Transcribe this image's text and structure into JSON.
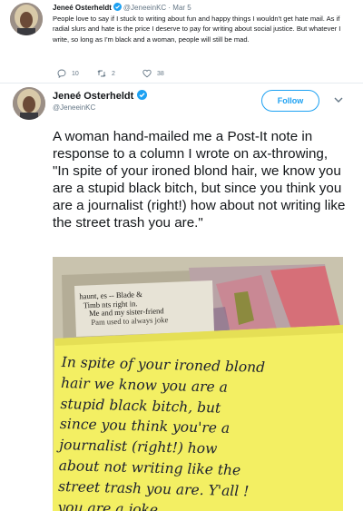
{
  "reply_tweet": {
    "display_name": "Jeneé Osterheldt",
    "handle": "@JeneeinKC",
    "date": "Mar 5",
    "text": "People love to say if I stuck to writing about fun and happy things I wouldn't get hate mail. As if radial slurs and hate is the price I deserve to pay for writing about social justice. But whatever I write, so long as I'm black and a woman, people will still be mad.",
    "replies": "10",
    "retweets": "2",
    "likes": "38"
  },
  "main_tweet": {
    "display_name": "Jeneé Osterheldt",
    "handle": "@JeneeinKC",
    "follow_label": "Follow",
    "text": "A woman hand-mailed me a Post-It note in response to a column I wrote on ax-throwing, \"In spite of your ironed blond hair, we know you are a stupid black bitch, but since you think you are a journalist (right!) how about not writing like the street trash you are.\""
  },
  "photo": {
    "clipping_lines": [
      "haunt,        es -- Blade &",
      "Timb      nts right in.",
      "Me and my sister-friend",
      "Pam used to always joke"
    ],
    "note_lines": [
      "In spite of your ironed blond",
      "hair we know you are a",
      "stupid black bitch, but",
      "since you think you're a",
      "journalist (right!) how",
      "about not writing like the",
      "street trash you are. Y'all !",
      "you are a joke"
    ]
  },
  "colors": {
    "brand_blue": "#1da1f2",
    "meta_gray": "#657786",
    "postit_yellow": "#f3ef63"
  },
  "icons": [
    "verified-badge-icon",
    "reply-icon",
    "retweet-icon",
    "like-icon",
    "chevron-down-icon"
  ]
}
